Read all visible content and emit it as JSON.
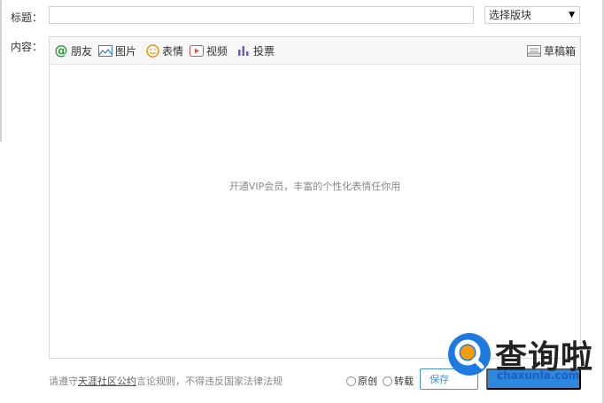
{
  "form": {
    "title_label": "标题：",
    "title_value": "",
    "board_select": "选择版块",
    "content_label": "内容："
  },
  "toolbar": {
    "friends": "朋友",
    "image": "图片",
    "emoji": "表情",
    "video": "视频",
    "vote": "投票",
    "drafts": "草稿箱"
  },
  "editor": {
    "vip_hint": "开通VIP会员，丰富的个性化表情任你用"
  },
  "footer": {
    "note_prefix": "请遵守",
    "note_link": "天涯社区公约",
    "note_suffix": "言论规则，不得违反国家法律法规",
    "original_label": "原创",
    "repost_label": "转载",
    "save_draft": "保存"
  },
  "watermark": {
    "brand": "查询啦",
    "url": "chaxunla.com"
  },
  "colors": {
    "accent": "#2e86de",
    "emoji_orange": "#f08c00",
    "video_red": "#d9534f",
    "vote_purple": "#6b5cc8",
    "friend_green": "#2a9d3a"
  }
}
